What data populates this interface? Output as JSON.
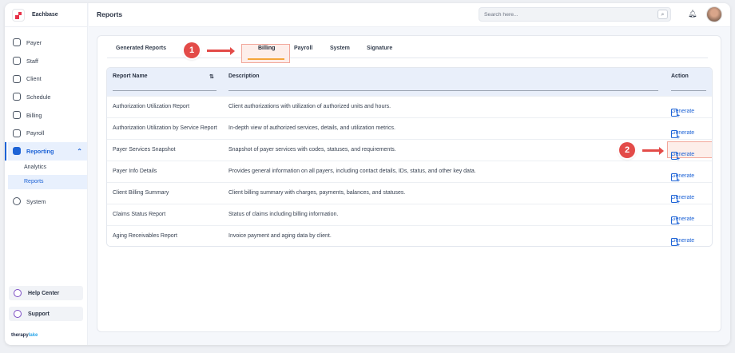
{
  "brand": {
    "name": "Eachbase"
  },
  "sidebar": {
    "items": [
      {
        "label": "Payer",
        "icon": "shield-icon"
      },
      {
        "label": "Staff",
        "icon": "users-icon"
      },
      {
        "label": "Client",
        "icon": "user-icon"
      },
      {
        "label": "Schedule",
        "icon": "calendar-icon"
      },
      {
        "label": "Billing",
        "icon": "receipt-icon"
      },
      {
        "label": "Payroll",
        "icon": "payroll-icon"
      },
      {
        "label": "Reporting",
        "icon": "report-icon"
      }
    ],
    "subitems": [
      {
        "label": "Analytics"
      },
      {
        "label": "Reports"
      }
    ],
    "system": {
      "label": "System"
    },
    "help": "Help Center",
    "support": "Support",
    "footer_a": "therapy",
    "footer_b": "lake"
  },
  "header": {
    "title": "Reports",
    "search_placeholder": "Search here..."
  },
  "tabs": [
    {
      "label": "Generated Reports"
    },
    {
      "label": "Billing"
    },
    {
      "label": "Payroll"
    },
    {
      "label": "System"
    },
    {
      "label": "Signature"
    }
  ],
  "annotations": [
    "1",
    "2"
  ],
  "table": {
    "headers": {
      "name": "Report Name",
      "sort": "⇅",
      "description": "Description",
      "action": "Action"
    },
    "action_label": "Generate",
    "rows": [
      {
        "name": "Authorization Utilization Report",
        "description": "Client authorizations with utilization of authorized units and hours."
      },
      {
        "name": "Authorization Utilization by Service Report",
        "description": "In-depth view of authorized services, details, and utilization metrics."
      },
      {
        "name": "Payer Services Snapshot",
        "description": "Snapshot of payer services with codes, statuses, and requirements."
      },
      {
        "name": "Payer Info Details",
        "description": "Provides general information on all payers, including contact details, IDs, status, and other key data."
      },
      {
        "name": "Client Billing Summary",
        "description": "Client billing summary with charges, payments, balances, and statuses."
      },
      {
        "name": "Claims Status Report",
        "description": "Status of claims including billing information."
      },
      {
        "name": "Aging Receivables Report",
        "description": "Invoice payment and aging data by client."
      }
    ]
  },
  "colors": {
    "accent": "#1d63d6",
    "annotation": "#e34b48",
    "tab_underline": "#f4a53a"
  }
}
